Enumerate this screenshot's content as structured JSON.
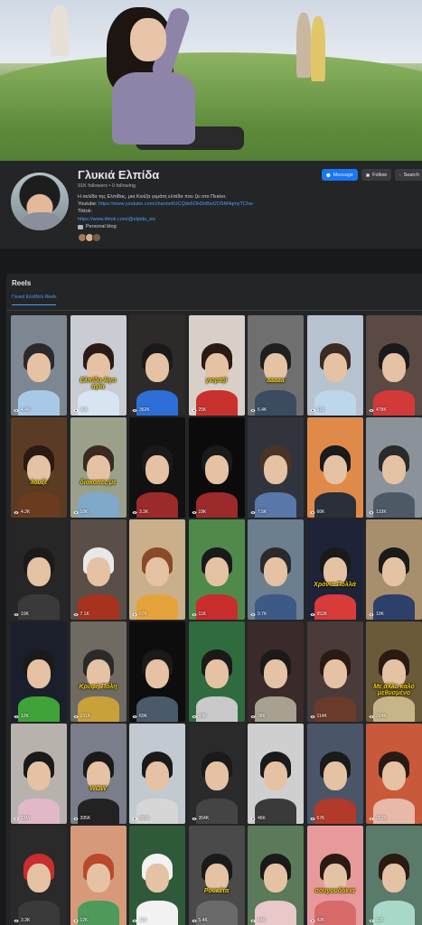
{
  "profile": {
    "name": "Γλυκιά Ελπίδα",
    "followers": "91K followers • 0 following",
    "bio_line1": "Η σελίδα της Ελπίδας, μια Κινέζα γεμάτη ελπίδα που ζει στο Πεκίνο.",
    "youtube_label": "Youtube:",
    "youtube_url": "https://www.youtube.com/channel/UCQdx6OH2eBwUOSM4qmyTChw",
    "tiktok_label": "Tiktok:",
    "tiktok_url": "https://www.tiktok.com/@elpida_ws",
    "category": "Personal blog"
  },
  "actions": {
    "message": "Message",
    "follow": "Follow",
    "search": "Search"
  },
  "reels": {
    "title": "Reels",
    "tab_label": "Γλυκιά Ελπίδα's Reels",
    "tiles": [
      {
        "views": "4.4K",
        "bg": "#7d8792",
        "hair": "#2a2a2a",
        "torso": "#a8c8e8",
        "caption": ""
      },
      {
        "views": "96K",
        "bg": "#c9ccd3",
        "hair": "#2a1b16",
        "torso": "#d9e4f2",
        "caption": "Ελπίδα λίγο αγία"
      },
      {
        "views": "352K",
        "bg": "#2e2a2a",
        "hair": "#1a1a1a",
        "torso": "#2d6fd6",
        "caption": ""
      },
      {
        "views": "25K",
        "bg": "#d8cfc8",
        "hair": "#2b1a14",
        "torso": "#c9312e",
        "caption": "γιορτή!"
      },
      {
        "views": "6.4K",
        "bg": "#6f6f6f",
        "hair": "#1f1f1f",
        "torso": "#3b4c60",
        "caption": "aaaaa"
      },
      {
        "views": "91K",
        "bg": "#b7c2cf",
        "hair": "#3b2b22",
        "torso": "#bcd6ea",
        "caption": ""
      },
      {
        "views": "478K",
        "bg": "#5a4a43",
        "hair": "#1a1a1a",
        "torso": "#d23a3a",
        "caption": ""
      },
      {
        "views": "4.2K",
        "bg": "#5a3b24",
        "hair": "#2a1a12",
        "torso": "#6b3b1f",
        "caption": "λουζε"
      },
      {
        "views": "18K",
        "bg": "#9aa08a",
        "hair": "#3a2a22",
        "torso": "#7fa8c9",
        "caption": "διακοπές με"
      },
      {
        "views": "3.3K",
        "bg": "#111111",
        "hair": "#1a1a1a",
        "torso": "#9c2a2a",
        "caption": ""
      },
      {
        "views": "19K",
        "bg": "#0b0b0b",
        "hair": "#1a1a1a",
        "torso": "#9c2a2a",
        "caption": ""
      },
      {
        "views": "7.5K",
        "bg": "#31343d",
        "hair": "#4a3426",
        "torso": "#5977a8",
        "caption": ""
      },
      {
        "views": "66K",
        "bg": "#e08a4a",
        "hair": "#1a1a1a",
        "torso": "#2a2f3a",
        "caption": ""
      },
      {
        "views": "133K",
        "bg": "#8c9299",
        "hair": "#2a2a2a",
        "torso": "#4e5968",
        "caption": ""
      },
      {
        "views": "10K",
        "bg": "#262626",
        "hair": "#1a1a1a",
        "torso": "#3a3a3a",
        "caption": ""
      },
      {
        "views": "7.1K",
        "bg": "#5a4e48",
        "hair": "#e8e8e8",
        "torso": "#a7331f",
        "caption": ""
      },
      {
        "views": "82K",
        "bg": "#c9b08a",
        "hair": "#8a4a2a",
        "torso": "#e6a23a",
        "caption": ""
      },
      {
        "views": "11K",
        "bg": "#4f8a4a",
        "hair": "#1a1a1a",
        "torso": "#c92d2d",
        "caption": ""
      },
      {
        "views": "9.7K",
        "bg": "#6c7f8f",
        "hair": "#2a2a2a",
        "torso": "#3d5a86",
        "caption": ""
      },
      {
        "views": "952K",
        "bg": "#1e2338",
        "hair": "#1a1a1a",
        "torso": "#d93a3a",
        "caption": "Χρόνια Πολλά"
      },
      {
        "views": "10K",
        "bg": "#a78f6d",
        "hair": "#1a1a1a",
        "torso": "#2d3f6b",
        "caption": ""
      },
      {
        "views": "12K",
        "bg": "#1a1f2b",
        "hair": "#1a1a1a",
        "torso": "#3fa33a",
        "caption": ""
      },
      {
        "views": "231K",
        "bg": "#6f6a62",
        "hair": "#2a2a2a",
        "torso": "#c9a13a",
        "caption": "Κρυφή Πόλη"
      },
      {
        "views": "60K",
        "bg": "#0d0d0d",
        "hair": "#1a1a1a",
        "torso": "#4a5a6a",
        "caption": ""
      },
      {
        "views": "43K",
        "bg": "#2f6b3c",
        "hair": "#1a1a1a",
        "torso": "#c9c9c9",
        "caption": ""
      },
      {
        "views": "38K",
        "bg": "#3a2a2a",
        "hair": "#1a1a1a",
        "torso": "#a8a090",
        "caption": ""
      },
      {
        "views": "114K",
        "bg": "#4a3b3a",
        "hair": "#2a1a14",
        "torso": "#6a3a2a",
        "caption": ""
      },
      {
        "views": "264K",
        "bg": "#6b5a3a",
        "hair": "#2a1a14",
        "torso": "#c7b58a",
        "caption": "Με άλλο καλό μεθυσμένο"
      },
      {
        "views": "19M",
        "bg": "#b8b2ad",
        "hair": "#1a1a1a",
        "torso": "#e1b8c8",
        "caption": ""
      },
      {
        "views": "395K",
        "bg": "#7a7e8a",
        "hair": "#1a1a1a",
        "torso": "#222222",
        "caption": "WOW"
      },
      {
        "views": "381K",
        "bg": "#c3c9d0",
        "hair": "#1a1a1a",
        "torso": "#d6d6d6",
        "caption": ""
      },
      {
        "views": "354K",
        "bg": "#2a2a2a",
        "hair": "#1a1a1a",
        "torso": "#444444",
        "caption": ""
      },
      {
        "views": "46K",
        "bg": "#cfcfcf",
        "hair": "#1a1a1a",
        "torso": "#3a3a3a",
        "caption": ""
      },
      {
        "views": "67K",
        "bg": "#4a5568",
        "hair": "#1a1a1a",
        "torso": "#b23a2a",
        "caption": ""
      },
      {
        "views": "353K",
        "bg": "#c8593a",
        "hair": "#2a1a14",
        "torso": "#e8b8a8",
        "caption": ""
      },
      {
        "views": "3.3K",
        "bg": "#2a2a2a",
        "hair": "#c92d2d",
        "torso": "#3a3a3a",
        "caption": ""
      },
      {
        "views": "12K",
        "bg": "#d69a7a",
        "hair": "#b84a2a",
        "torso": "#4f9a5a",
        "caption": ""
      },
      {
        "views": "11K",
        "bg": "#2f5a3a",
        "hair": "#f2f2f2",
        "torso": "#f2f2f2",
        "caption": ""
      },
      {
        "views": "5.4K",
        "bg": "#4a4a4a",
        "hair": "#1a1a1a",
        "torso": "#6a6a6a",
        "caption": "Ρουκέτα"
      },
      {
        "views": "48K",
        "bg": "#5a7a5a",
        "hair": "#1a1a1a",
        "torso": "#e8c8c8",
        "caption": ""
      },
      {
        "views": "42K",
        "bg": "#e89a9a",
        "hair": "#2a1a14",
        "torso": "#d86a6a",
        "caption": "σουγουδάκια"
      },
      {
        "views": "11K",
        "bg": "#5a7a6a",
        "hair": "#2a1a14",
        "torso": "#a7d8c8",
        "caption": ""
      }
    ]
  }
}
